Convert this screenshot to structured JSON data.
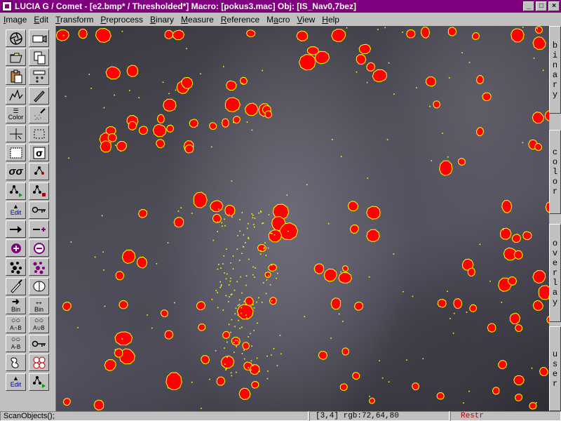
{
  "window": {
    "title": "LUCIA G / Comet - [e2.bmp* / Thresholded*]  Macro: [pokus3.mac]  Obj: [IS_Nav0,7bez]",
    "minimize_label": "_",
    "maximize_label": "□",
    "close_label": "×"
  },
  "menu": [
    {
      "label": "Image",
      "underline_index": 0
    },
    {
      "label": "Edit",
      "underline_index": 0
    },
    {
      "label": "Transform",
      "underline_index": 0
    },
    {
      "label": "Preprocess",
      "underline_index": 0
    },
    {
      "label": "Binary",
      "underline_index": 0
    },
    {
      "label": "Measure",
      "underline_index": 0
    },
    {
      "label": "Reference",
      "underline_index": 0
    },
    {
      "label": "Macro",
      "underline_index": 1
    },
    {
      "label": "View",
      "underline_index": 0
    },
    {
      "label": "Help",
      "underline_index": 0
    }
  ],
  "toolbox": {
    "tools": [
      {
        "name": "aperture-icon",
        "glyph": "aperture"
      },
      {
        "name": "camera-icon",
        "glyph": "camera"
      },
      {
        "name": "open-file-icon",
        "glyph": "open"
      },
      {
        "name": "copy-icon",
        "glyph": "copy"
      },
      {
        "name": "paste-icon",
        "glyph": "paste"
      },
      {
        "name": "grid-plus-icon",
        "glyph": "gridplus"
      },
      {
        "name": "profile-graph-icon",
        "glyph": "graph"
      },
      {
        "name": "pen-icon",
        "glyph": "pen"
      },
      {
        "name": "color-icon",
        "glyph": "color",
        "label": "Color"
      },
      {
        "name": "spray-icon",
        "glyph": "spray"
      },
      {
        "name": "crosshair-icon",
        "glyph": "cross"
      },
      {
        "name": "frame-select-icon",
        "glyph": "frame"
      },
      {
        "name": "selection-rect-icon",
        "glyph": "selrect"
      },
      {
        "name": "sigma-icon",
        "glyph": "sigma"
      },
      {
        "name": "double-sigma-icon",
        "glyph": "sigma2"
      },
      {
        "name": "tree-red-icon",
        "glyph": "treered"
      },
      {
        "name": "tree-green-play-icon",
        "glyph": "treegreen"
      },
      {
        "name": "tree-stop-icon",
        "glyph": "treestop"
      },
      {
        "name": "edit-tree-icon",
        "glyph": "edit",
        "label": "Edit"
      },
      {
        "name": "key-icon",
        "glyph": "key"
      },
      {
        "name": "arrow-right-icon",
        "glyph": "arrow"
      },
      {
        "name": "minus-plus-icon",
        "glyph": "minusplus"
      },
      {
        "name": "add-circle-icon",
        "glyph": "addc"
      },
      {
        "name": "remove-circle-icon",
        "glyph": "remc"
      },
      {
        "name": "particles-dark-icon",
        "glyph": "dotsdark"
      },
      {
        "name": "particles-purple-icon",
        "glyph": "dotspurple"
      },
      {
        "name": "brush-icon",
        "glyph": "brush"
      },
      {
        "name": "split-object-icon",
        "glyph": "split"
      },
      {
        "name": "binary-right-icon",
        "glyph": "binright",
        "label": "Bin"
      },
      {
        "name": "binary-both-icon",
        "glyph": "binboth",
        "label": "Bin"
      },
      {
        "name": "and-b-icon",
        "glyph": "andb",
        "label": "A∩B"
      },
      {
        "name": "or-b-icon",
        "glyph": "orb",
        "label": "A∪B"
      },
      {
        "name": "a-minus-b-icon",
        "glyph": "aminusb",
        "label": "A-B"
      },
      {
        "name": "key-small-icon",
        "glyph": "key"
      },
      {
        "name": "contour-icon",
        "glyph": "contour"
      },
      {
        "name": "double-contour-icon",
        "glyph": "contour2"
      },
      {
        "name": "edit-tree-icon-2",
        "glyph": "edit",
        "label": "Edit"
      },
      {
        "name": "tree-green-play-icon-2",
        "glyph": "treegreen"
      }
    ]
  },
  "side_tabs": [
    {
      "name": "tab-binary",
      "label": "binary"
    },
    {
      "name": "tab-color",
      "label": "color"
    },
    {
      "name": "tab-overlay",
      "label": "overlay"
    },
    {
      "name": "tab-user",
      "label": "user"
    }
  ],
  "status": {
    "command": "ScanObjects();",
    "coords": "[3,4] rgb:72,64,80",
    "restr": "Restr"
  },
  "colors": {
    "titlebar": "#800080",
    "object_fill": "#ff0000",
    "object_outline": "#ffff00",
    "restr_text": "#c00000"
  }
}
